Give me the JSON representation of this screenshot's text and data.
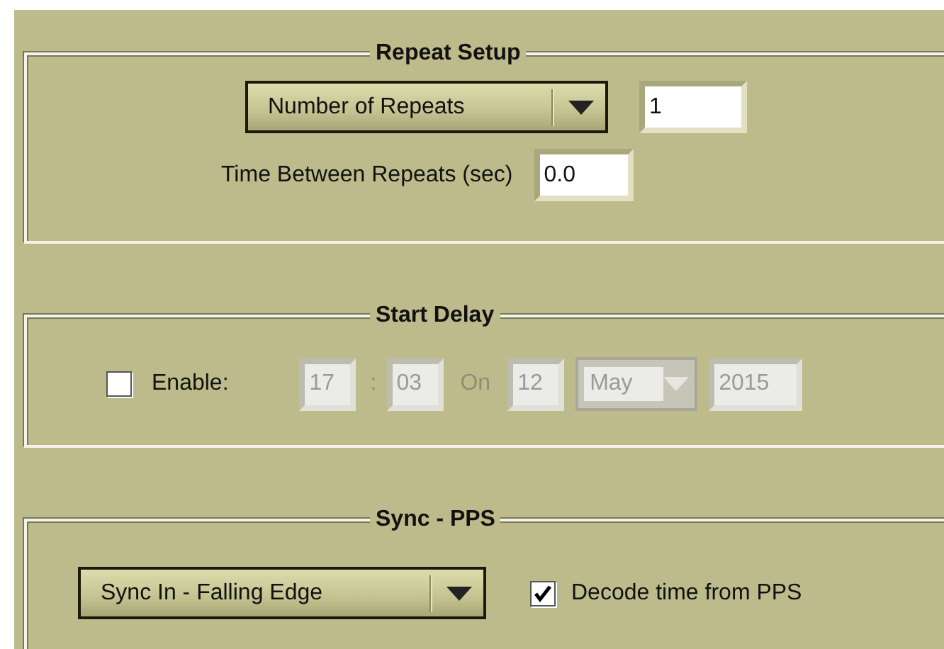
{
  "repeat_setup": {
    "title": "Repeat Setup",
    "mode_dropdown": {
      "value": "Number of Repeats"
    },
    "repeats_field": {
      "value": "1"
    },
    "time_between": {
      "label": "Time Between Repeats (sec)",
      "value": "0.0"
    }
  },
  "start_delay": {
    "title": "Start Delay",
    "enable": {
      "label": "Enable:",
      "checked": false
    },
    "hour": {
      "value": "17",
      "disabled": true
    },
    "separator": ":",
    "minute": {
      "value": "03",
      "disabled": true
    },
    "on_label": "On",
    "day": {
      "value": "12",
      "disabled": true
    },
    "month": {
      "value": "May",
      "disabled": true
    },
    "year": {
      "value": "2015",
      "disabled": true
    }
  },
  "sync_pps": {
    "title": "Sync - PPS",
    "mode_dropdown": {
      "value": "Sync In - Falling Edge"
    },
    "decode_time": {
      "label": "Decode time from PPS",
      "checked": true
    }
  }
}
